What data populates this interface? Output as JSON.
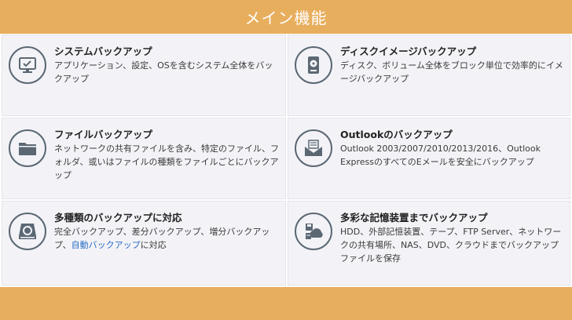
{
  "header": {
    "title": "メイン機能"
  },
  "cards": [
    {
      "title": "システムバックアップ",
      "desc": "アプリケーション、設定、OSを含むシステム全体をバックアップ",
      "icon": "monitor-check-icon"
    },
    {
      "title": "ディスクイメージバックアップ",
      "desc": "ディスク、ボリューム全体をブロック単位で効率的にイメージバックアップ",
      "icon": "hard-disk-icon"
    },
    {
      "title": "ファイルバックアップ",
      "desc": "ネットワークの共有ファイルを含み、特定のファイル、フォルダ、或いはファイルの種類をファイルごとにバックアップ",
      "icon": "folder-icon"
    },
    {
      "title": "Outlookのバックアップ",
      "desc": "Outlook 2003/2007/2010/2013/2016、Outlook ExpressのすべてのEメールを安全にバックアップ",
      "icon": "envelope-icon"
    },
    {
      "title": "多種類のバックアップに対応",
      "desc_pre": "完全バックアップ、差分バックアップ、増分バックアップ、",
      "desc_link": "自動バックアップ",
      "desc_post": "に対応",
      "icon": "backup-drive-icon"
    },
    {
      "title": "多彩な記憶装置までバックアップ",
      "desc": "HDD、外部記憶装置、テープ、FTP Server、ネットワークの共有場所、NAS、DVD、クラウドまでバックアップファイルを保存",
      "icon": "storage-cloud-icon"
    }
  ]
}
